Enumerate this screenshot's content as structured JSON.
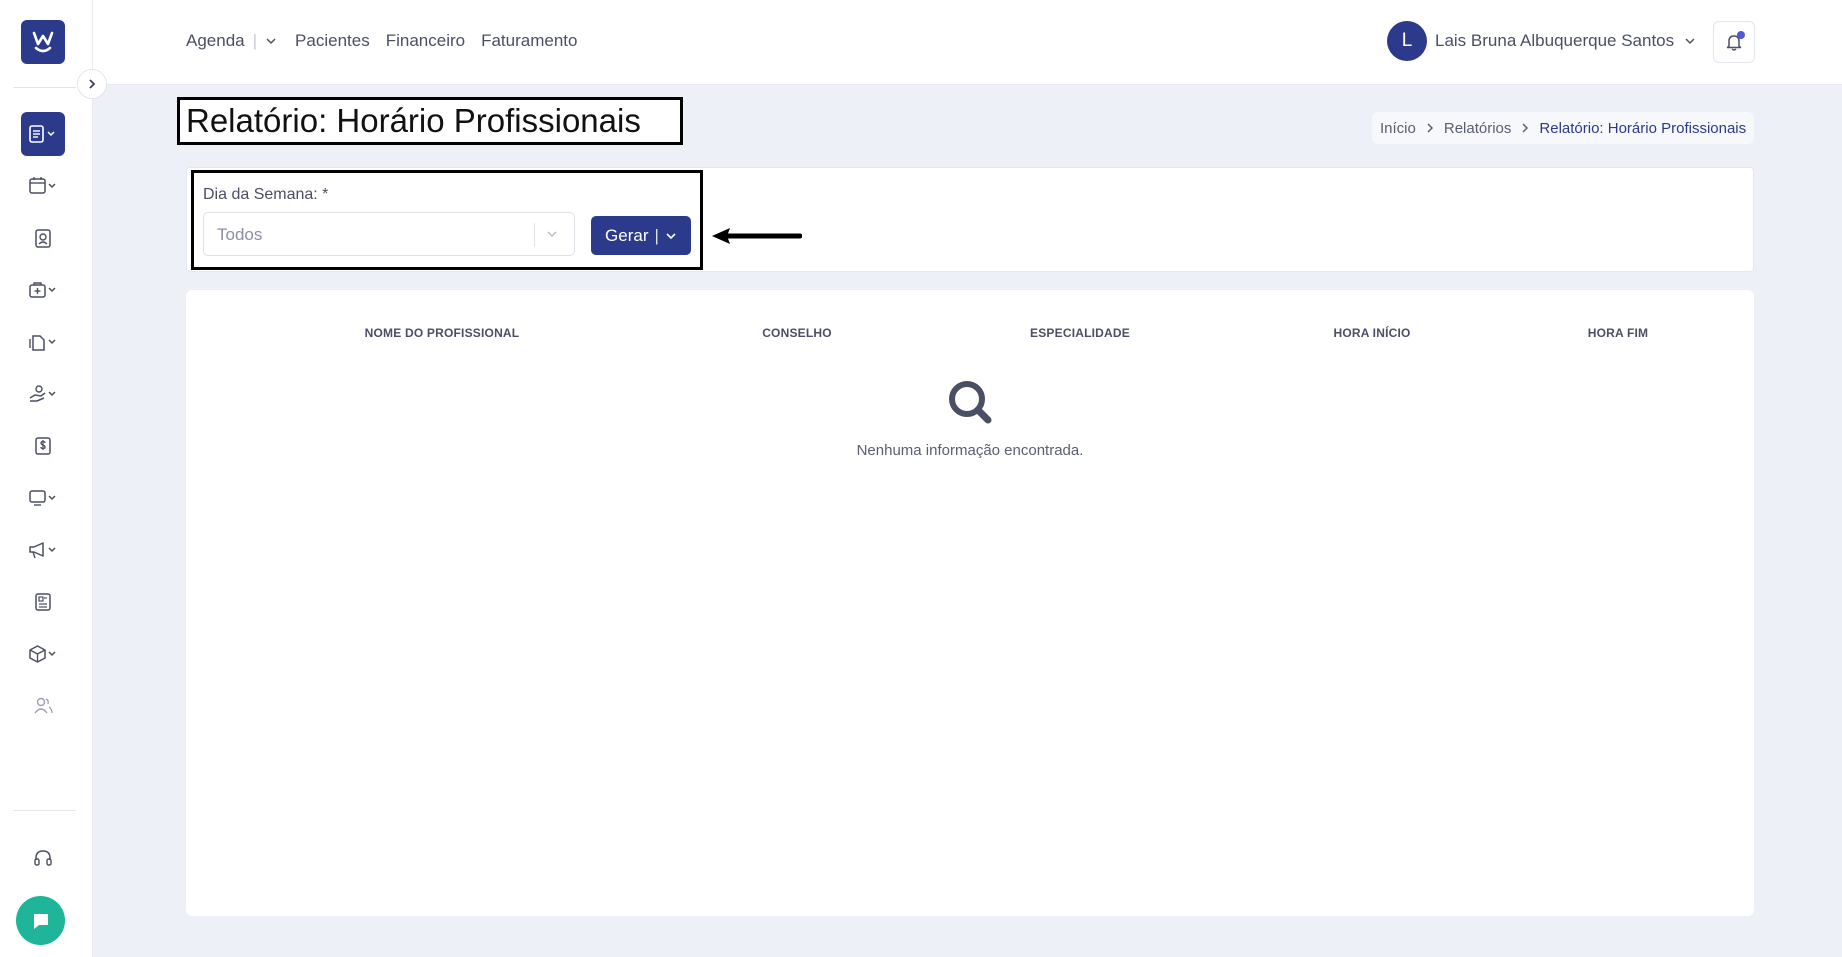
{
  "topbar": {
    "nav": [
      {
        "label": "Agenda",
        "has_dropdown": true
      },
      {
        "label": "Pacientes"
      },
      {
        "label": "Financeiro"
      },
      {
        "label": "Faturamento"
      }
    ],
    "user": {
      "initial": "L",
      "name": "Lais Bruna Albuquerque Santos"
    }
  },
  "sidebar": {
    "logo_icon": "w-logo-icon",
    "items": [
      {
        "icon": "report-icon",
        "active": true,
        "has_dropdown": true
      },
      {
        "icon": "calendar-icon",
        "has_dropdown": true
      },
      {
        "icon": "patient-badge-icon"
      },
      {
        "icon": "medical-kit-icon",
        "has_dropdown": true
      },
      {
        "icon": "documents-icon",
        "has_dropdown": true
      },
      {
        "icon": "hand-money-icon",
        "has_dropdown": true
      },
      {
        "icon": "dollar-icon"
      },
      {
        "icon": "monitor-icon",
        "has_dropdown": true
      },
      {
        "icon": "megaphone-icon",
        "has_dropdown": true
      },
      {
        "icon": "newspaper-icon"
      },
      {
        "icon": "box-icon",
        "has_dropdown": true
      },
      {
        "icon": "users-icon"
      }
    ],
    "support_icon": "headset-icon",
    "chat_icon": "chat-icon"
  },
  "page": {
    "title": "Relatório: Horário Profissionais",
    "breadcrumb": [
      "Início",
      "Relatórios",
      "Relatório: Horário Profissionais"
    ]
  },
  "filter": {
    "label": "Dia da Semana: *",
    "value": "Todos",
    "button_label": "Gerar"
  },
  "table": {
    "columns": [
      "NOME DO PROFISSIONAL",
      "CONSELHO",
      "ESPECIALIDADE",
      "HORA INÍCIO",
      "HORA FIM"
    ],
    "rows": [],
    "empty_message": "Nenhuma informação encontrada."
  },
  "colors": {
    "primary": "#2c3a8c",
    "background": "#eef0f8",
    "chat": "#1fb59a"
  }
}
